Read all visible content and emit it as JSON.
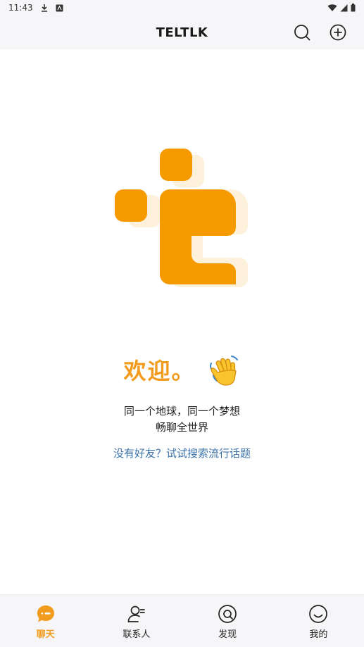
{
  "status_bar": {
    "time": "11:43",
    "icons": [
      "download-icon",
      "app-notification-icon",
      "wifi-icon",
      "signal-icon",
      "battery-icon"
    ]
  },
  "app_bar": {
    "title": "TELTLK",
    "actions": [
      "search-icon",
      "add-icon"
    ]
  },
  "welcome": {
    "title": "欢迎。",
    "emoji_icon": "waving-hand-icon",
    "tagline_line1": "同一个地球，同一个梦想",
    "tagline_line2": "畅聊全世界",
    "hint_link": "没有好友？试试搜索流行话题"
  },
  "bottom_nav": {
    "items": [
      {
        "label": "聊天",
        "icon": "chat-bubble-icon",
        "active": true
      },
      {
        "label": "联系人",
        "icon": "contacts-icon",
        "active": false
      },
      {
        "label": "发现",
        "icon": "discover-icon",
        "active": false
      },
      {
        "label": "我的",
        "icon": "smiley-face-icon",
        "active": false
      }
    ]
  },
  "colors": {
    "brand_orange": "#f29c1f",
    "link_blue": "#3b72a8",
    "bar_background": "#f6f6f8"
  }
}
